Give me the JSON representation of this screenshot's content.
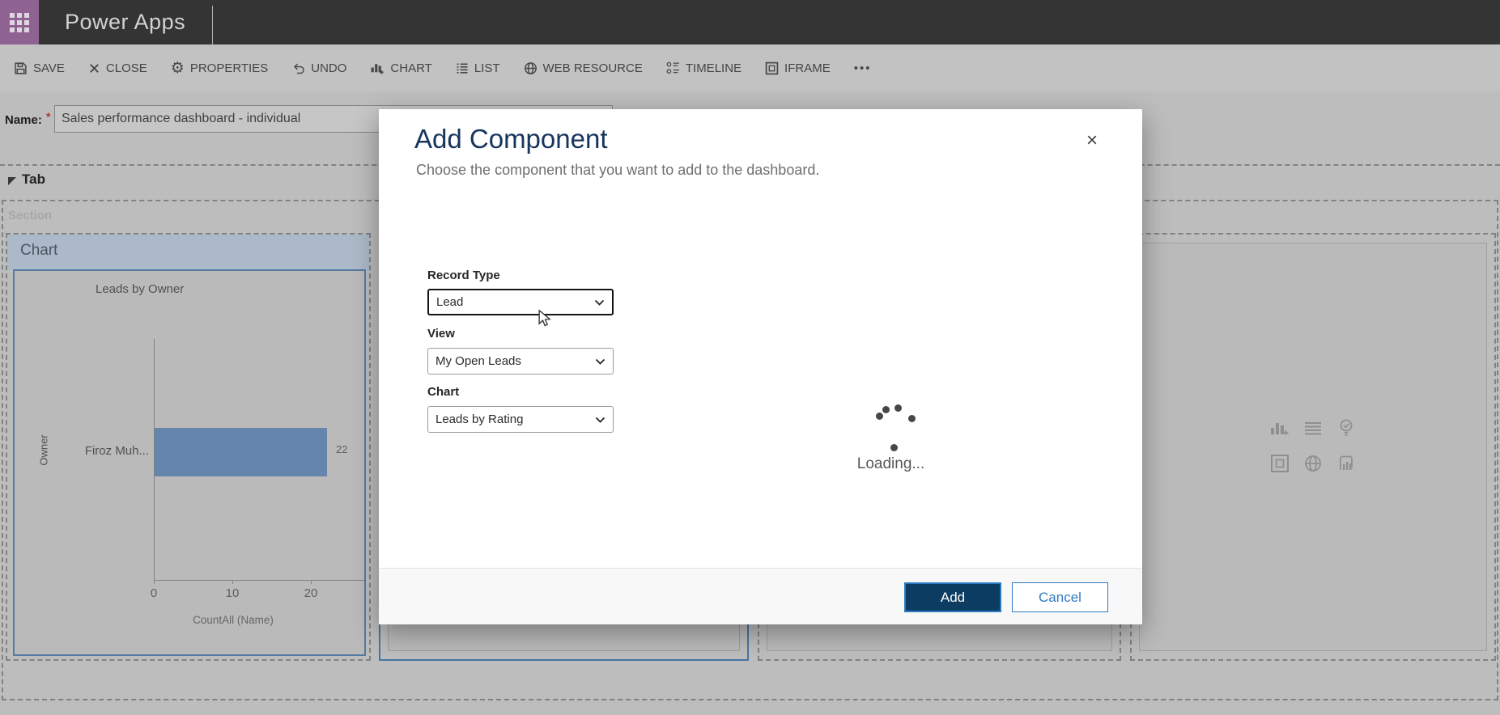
{
  "app": {
    "title": "Power Apps"
  },
  "toolbar": {
    "items": [
      {
        "label": "SAVE"
      },
      {
        "label": "CLOSE"
      },
      {
        "label": "PROPERTIES"
      },
      {
        "label": "UNDO"
      },
      {
        "label": "CHART"
      },
      {
        "label": "LIST"
      },
      {
        "label": "WEB RESOURCE"
      },
      {
        "label": "TIMELINE"
      },
      {
        "label": "IFRAME"
      }
    ],
    "more_label": "•••"
  },
  "form": {
    "name_label": "Name:",
    "required_marker": "*",
    "name_value": "Sales performance dashboard - individual"
  },
  "canvas": {
    "tab_label": "Tab",
    "section_label": "Section",
    "chart_panel_header": "Chart"
  },
  "chart_data": {
    "type": "bar",
    "orientation": "horizontal",
    "title": "Leads by Owner",
    "categories": [
      "Firoz Muh..."
    ],
    "values": [
      22
    ],
    "xlabel": "CountAll (Name)",
    "ylabel": "Owner",
    "xticks": [
      0,
      10,
      20
    ],
    "xlim": [
      0,
      27
    ],
    "grid": false,
    "bar_color": "#6e90ba"
  },
  "modal": {
    "title": "Add Component",
    "subtitle": "Choose the component that you want to add to the dashboard.",
    "close_label": "×",
    "fields": [
      {
        "label": "Record Type",
        "value": "Lead"
      },
      {
        "label": "View",
        "value": "My Open Leads"
      },
      {
        "label": "Chart",
        "value": "Leads by Rating"
      }
    ],
    "loading_text": "Loading...",
    "add_label": "Add",
    "cancel_label": "Cancel"
  }
}
